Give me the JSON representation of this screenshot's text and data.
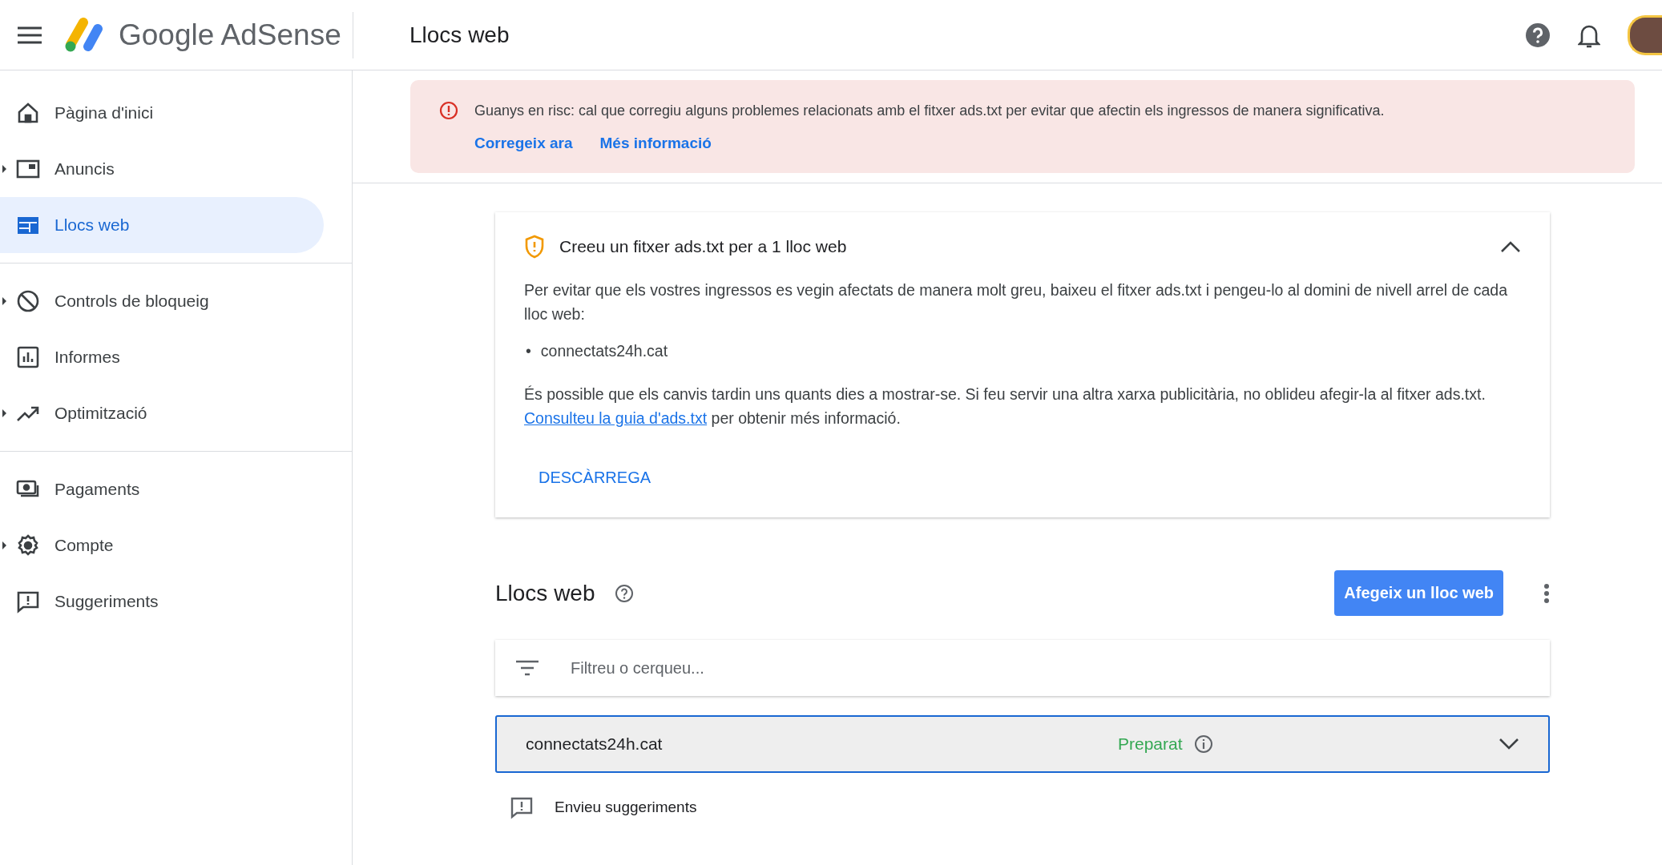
{
  "header": {
    "product": "Google AdSense",
    "page_title": "Llocs web"
  },
  "sidebar": {
    "groups": [
      [
        {
          "label": "Pàgina d'inici",
          "expandable": false,
          "selected": false
        },
        {
          "label": "Anuncis",
          "expandable": true,
          "selected": false
        },
        {
          "label": "Llocs web",
          "expandable": false,
          "selected": true
        }
      ],
      [
        {
          "label": "Controls de bloqueig",
          "expandable": true,
          "selected": false
        },
        {
          "label": "Informes",
          "expandable": false,
          "selected": false
        },
        {
          "label": "Optimització",
          "expandable": true,
          "selected": false
        }
      ],
      [
        {
          "label": "Pagaments",
          "expandable": false,
          "selected": false
        },
        {
          "label": "Compte",
          "expandable": true,
          "selected": false
        },
        {
          "label": "Suggeriments",
          "expandable": false,
          "selected": false
        }
      ]
    ]
  },
  "alert": {
    "message": "Guanys en risc: cal que corregiu alguns problemes relacionats amb el fitxer ads.txt per evitar que afectin els ingressos de manera significativa.",
    "links": [
      "Corregeix ara",
      "Més informació"
    ]
  },
  "ads_txt_card": {
    "title": "Creeu un fitxer ads.txt per a 1 lloc web",
    "expanded": true,
    "intro": "Per evitar que els vostres ingressos es vegin afectats de manera molt greu, baixeu el fitxer ads.txt i pengeu-lo al domini de nivell arrel de cada lloc web:",
    "sites": [
      {
        "bullet": "•",
        "text": "connectats24h.cat"
      }
    ],
    "note_before": "És possible que els canvis tardin uns quants dies a mostrar-se. Si feu servir una altra xarxa publicitària, no oblideu afegir-la al fitxer ads.txt.",
    "note_link": "Consulteu la guia d'ads.txt",
    "note_after": "per obtenir més informació.",
    "action": "DESCÀRREGA"
  },
  "sites_section": {
    "title": "Llocs web",
    "add_button": "Afegeix un lloc web",
    "filter": {
      "placeholder": "Filtreu o cerqueu..."
    },
    "rows": [
      {
        "domain": "connectats24h.cat",
        "status": "Preparat",
        "expanded": false
      }
    ]
  },
  "feedback": "Envieu suggeriments"
}
